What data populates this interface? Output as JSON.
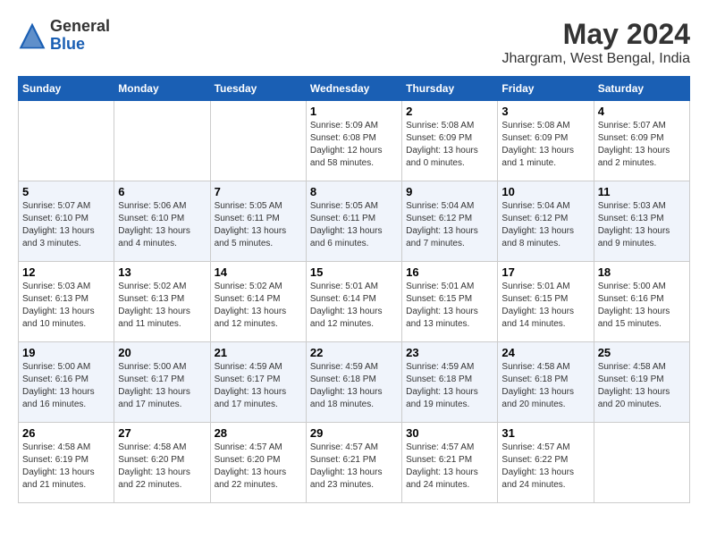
{
  "logo": {
    "general": "General",
    "blue": "Blue"
  },
  "title": "May 2024",
  "subtitle": "Jhargram, West Bengal, India",
  "days_header": [
    "Sunday",
    "Monday",
    "Tuesday",
    "Wednesday",
    "Thursday",
    "Friday",
    "Saturday"
  ],
  "weeks": [
    [
      {
        "num": "",
        "info": ""
      },
      {
        "num": "",
        "info": ""
      },
      {
        "num": "",
        "info": ""
      },
      {
        "num": "1",
        "info": "Sunrise: 5:09 AM\nSunset: 6:08 PM\nDaylight: 12 hours\nand 58 minutes."
      },
      {
        "num": "2",
        "info": "Sunrise: 5:08 AM\nSunset: 6:09 PM\nDaylight: 13 hours\nand 0 minutes."
      },
      {
        "num": "3",
        "info": "Sunrise: 5:08 AM\nSunset: 6:09 PM\nDaylight: 13 hours\nand 1 minute."
      },
      {
        "num": "4",
        "info": "Sunrise: 5:07 AM\nSunset: 6:09 PM\nDaylight: 13 hours\nand 2 minutes."
      }
    ],
    [
      {
        "num": "5",
        "info": "Sunrise: 5:07 AM\nSunset: 6:10 PM\nDaylight: 13 hours\nand 3 minutes."
      },
      {
        "num": "6",
        "info": "Sunrise: 5:06 AM\nSunset: 6:10 PM\nDaylight: 13 hours\nand 4 minutes."
      },
      {
        "num": "7",
        "info": "Sunrise: 5:05 AM\nSunset: 6:11 PM\nDaylight: 13 hours\nand 5 minutes."
      },
      {
        "num": "8",
        "info": "Sunrise: 5:05 AM\nSunset: 6:11 PM\nDaylight: 13 hours\nand 6 minutes."
      },
      {
        "num": "9",
        "info": "Sunrise: 5:04 AM\nSunset: 6:12 PM\nDaylight: 13 hours\nand 7 minutes."
      },
      {
        "num": "10",
        "info": "Sunrise: 5:04 AM\nSunset: 6:12 PM\nDaylight: 13 hours\nand 8 minutes."
      },
      {
        "num": "11",
        "info": "Sunrise: 5:03 AM\nSunset: 6:13 PM\nDaylight: 13 hours\nand 9 minutes."
      }
    ],
    [
      {
        "num": "12",
        "info": "Sunrise: 5:03 AM\nSunset: 6:13 PM\nDaylight: 13 hours\nand 10 minutes."
      },
      {
        "num": "13",
        "info": "Sunrise: 5:02 AM\nSunset: 6:13 PM\nDaylight: 13 hours\nand 11 minutes."
      },
      {
        "num": "14",
        "info": "Sunrise: 5:02 AM\nSunset: 6:14 PM\nDaylight: 13 hours\nand 12 minutes."
      },
      {
        "num": "15",
        "info": "Sunrise: 5:01 AM\nSunset: 6:14 PM\nDaylight: 13 hours\nand 12 minutes."
      },
      {
        "num": "16",
        "info": "Sunrise: 5:01 AM\nSunset: 6:15 PM\nDaylight: 13 hours\nand 13 minutes."
      },
      {
        "num": "17",
        "info": "Sunrise: 5:01 AM\nSunset: 6:15 PM\nDaylight: 13 hours\nand 14 minutes."
      },
      {
        "num": "18",
        "info": "Sunrise: 5:00 AM\nSunset: 6:16 PM\nDaylight: 13 hours\nand 15 minutes."
      }
    ],
    [
      {
        "num": "19",
        "info": "Sunrise: 5:00 AM\nSunset: 6:16 PM\nDaylight: 13 hours\nand 16 minutes."
      },
      {
        "num": "20",
        "info": "Sunrise: 5:00 AM\nSunset: 6:17 PM\nDaylight: 13 hours\nand 17 minutes."
      },
      {
        "num": "21",
        "info": "Sunrise: 4:59 AM\nSunset: 6:17 PM\nDaylight: 13 hours\nand 17 minutes."
      },
      {
        "num": "22",
        "info": "Sunrise: 4:59 AM\nSunset: 6:18 PM\nDaylight: 13 hours\nand 18 minutes."
      },
      {
        "num": "23",
        "info": "Sunrise: 4:59 AM\nSunset: 6:18 PM\nDaylight: 13 hours\nand 19 minutes."
      },
      {
        "num": "24",
        "info": "Sunrise: 4:58 AM\nSunset: 6:18 PM\nDaylight: 13 hours\nand 20 minutes."
      },
      {
        "num": "25",
        "info": "Sunrise: 4:58 AM\nSunset: 6:19 PM\nDaylight: 13 hours\nand 20 minutes."
      }
    ],
    [
      {
        "num": "26",
        "info": "Sunrise: 4:58 AM\nSunset: 6:19 PM\nDaylight: 13 hours\nand 21 minutes."
      },
      {
        "num": "27",
        "info": "Sunrise: 4:58 AM\nSunset: 6:20 PM\nDaylight: 13 hours\nand 22 minutes."
      },
      {
        "num": "28",
        "info": "Sunrise: 4:57 AM\nSunset: 6:20 PM\nDaylight: 13 hours\nand 22 minutes."
      },
      {
        "num": "29",
        "info": "Sunrise: 4:57 AM\nSunset: 6:21 PM\nDaylight: 13 hours\nand 23 minutes."
      },
      {
        "num": "30",
        "info": "Sunrise: 4:57 AM\nSunset: 6:21 PM\nDaylight: 13 hours\nand 24 minutes."
      },
      {
        "num": "31",
        "info": "Sunrise: 4:57 AM\nSunset: 6:22 PM\nDaylight: 13 hours\nand 24 minutes."
      },
      {
        "num": "",
        "info": ""
      }
    ]
  ]
}
